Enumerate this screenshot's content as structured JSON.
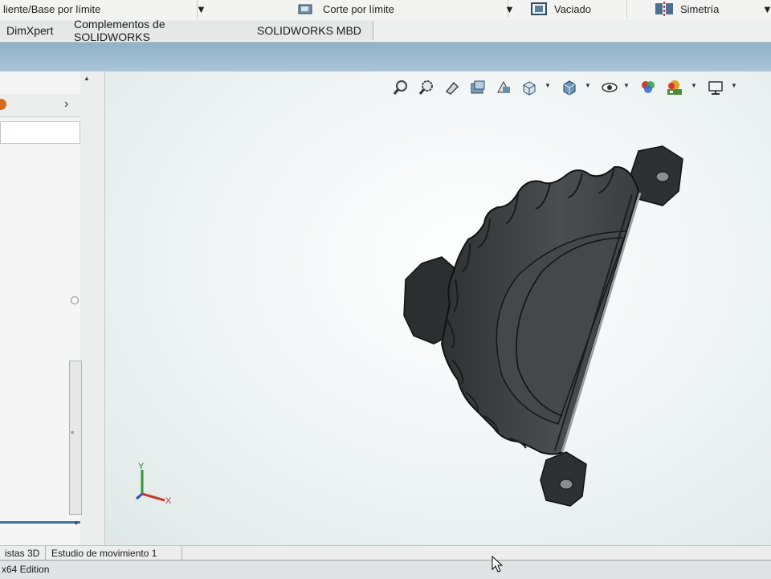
{
  "ribbon": {
    "item1": "liente/Base por límite",
    "item2": "Corte por límite",
    "item3": "Vaciado",
    "item4": "Simetría"
  },
  "tabs": [
    "DimXpert",
    "Complementos de SOLIDWORKS",
    "SOLIDWORKS MBD"
  ],
  "bottom_tabs": [
    "istas 3D",
    "Estudio de movimiento 1"
  ],
  "status": {
    "edition": "x64 Edition"
  },
  "triad": {
    "x": "X",
    "y": "Y"
  },
  "view_tools": [
    "zoom-to-fit-icon",
    "zoom-to-area-icon",
    "previous-view-icon",
    "section-view-icon",
    "dynamic-annotation-icon",
    "view-orientation-icon",
    "display-style-icon",
    "hide-show-icon",
    "edit-appearance-icon",
    "apply-scene-icon",
    "view-settings-icon"
  ],
  "colors": {
    "model": "#3f4242",
    "accent_blue": "#2f6f9f",
    "viewport_bg": "#f2f6f6"
  }
}
